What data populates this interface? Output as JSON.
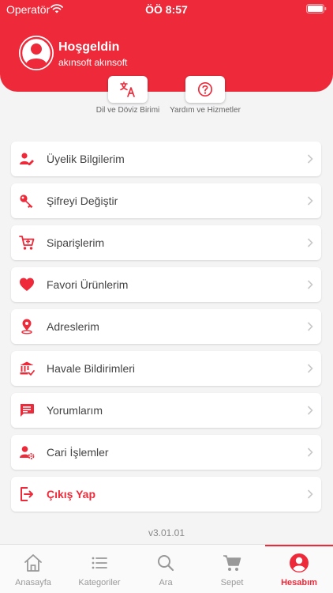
{
  "status_bar": {
    "carrier": "Operatör",
    "time": "ÖÖ 8:57"
  },
  "header": {
    "greeting": "Hoşgeldin",
    "username": "akınsoft akınsoft"
  },
  "quick_actions": [
    {
      "label": "Dil ve Döviz Birimi",
      "icon": "translate-icon"
    },
    {
      "label": "Yardım ve Hizmetler",
      "icon": "help-icon"
    }
  ],
  "menu": [
    {
      "label": "Üyelik Bilgilerim",
      "icon": "user-edit-icon"
    },
    {
      "label": "Şifreyi Değiştir",
      "icon": "key-icon"
    },
    {
      "label": "Siparişlerim",
      "icon": "cart-icon"
    },
    {
      "label": "Favori Ürünlerim",
      "icon": "heart-icon"
    },
    {
      "label": "Adreslerim",
      "icon": "location-pin-icon"
    },
    {
      "label": "Havale Bildirimleri",
      "icon": "bank-icon"
    },
    {
      "label": "Yorumlarım",
      "icon": "comment-icon"
    },
    {
      "label": "Cari İşlemler",
      "icon": "user-settings-icon"
    },
    {
      "label": "Çıkış Yap",
      "icon": "logout-icon"
    }
  ],
  "version": "v3.01.01",
  "tabs": [
    {
      "label": "Anasayfa",
      "icon": "home-icon"
    },
    {
      "label": "Kategoriler",
      "icon": "list-icon"
    },
    {
      "label": "Ara",
      "icon": "search-icon"
    },
    {
      "label": "Sepet",
      "icon": "cart-icon"
    },
    {
      "label": "Hesabım",
      "icon": "account-icon"
    }
  ],
  "active_tab": "Hesabım",
  "colors": {
    "brand": "#ee2a3a",
    "background": "#f4f4f5",
    "tab_inactive": "#999999"
  }
}
